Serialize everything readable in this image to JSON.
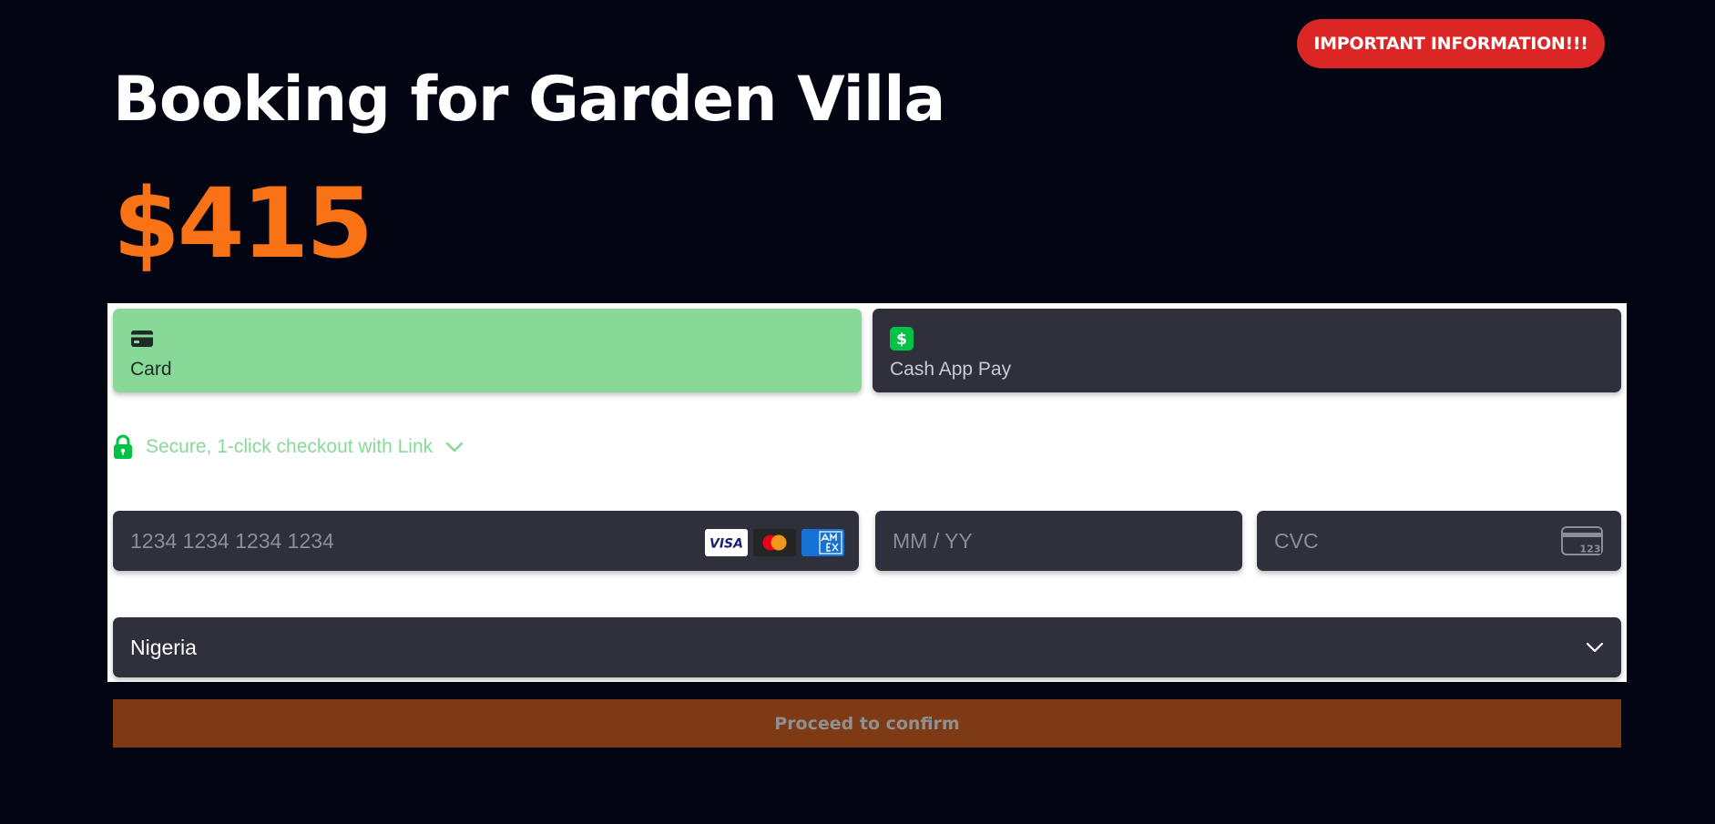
{
  "header": {
    "important_button_label": "IMPORTANT INFORMATION!!!",
    "title": "Booking for Garden Villa",
    "price": "$415"
  },
  "payment": {
    "tabs": [
      {
        "label": "Card",
        "icon": "credit-card-icon",
        "selected": true
      },
      {
        "label": "Cash App Pay",
        "icon": "cash-app-icon",
        "selected": false
      }
    ],
    "link_checkout_text": "Secure, 1-click checkout with Link",
    "card_number_placeholder": "1234 1234 1234 1234",
    "card_brands": [
      "visa-logo",
      "mastercard-logo",
      "amex-logo"
    ],
    "expiry_placeholder": "MM / YY",
    "cvc_placeholder": "CVC",
    "country_selected": "Nigeria"
  },
  "actions": {
    "proceed_label": "Proceed to confirm"
  },
  "colors": {
    "background": "#030612",
    "accent_orange": "#f97316",
    "selected_tab": "#88d997",
    "field_bg": "#30303d",
    "important_red": "#dc2626",
    "proceed_bg": "#7d3a15"
  }
}
